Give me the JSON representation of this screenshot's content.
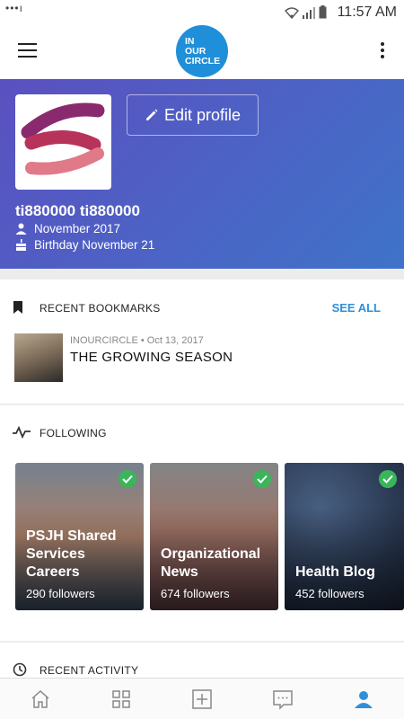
{
  "status_bar": {
    "time": "11:57 AM"
  },
  "app_bar": {
    "logo_text_1": "IN",
    "logo_text_2": "OUR",
    "logo_text_3": "CIRCLE",
    "brand_color": "#1f8fd9"
  },
  "profile": {
    "edit_label": "Edit profile",
    "username": "ti880000 ti880000",
    "joined": "November 2017",
    "birthday": "Birthday November 21",
    "header_colors": [
      "#5b50c0",
      "#3f73c9"
    ]
  },
  "bookmarks": {
    "title": "RECENT BOOKMARKS",
    "see_all": "SEE ALL",
    "item": {
      "source": "INOURCIRCLE",
      "date": "Oct 13, 2017",
      "title": "THE GROWING SEASON"
    }
  },
  "following": {
    "title": "FOLLOWING",
    "cards": [
      {
        "name_1": "PSJH Shared",
        "name_2": "Services Careers",
        "followers": "290 followers"
      },
      {
        "name_1": "Organizational",
        "name_2": "News",
        "followers": "674 followers"
      },
      {
        "name_1": "",
        "name_2": "Health Blog",
        "followers": "452 followers"
      }
    ]
  },
  "activity": {
    "title": "RECENT ACTIVITY"
  },
  "accent_color": "#2f8fd8",
  "check_color": "#3ab55a",
  "bottom_nav": {
    "items": [
      "home-icon",
      "grid-icon",
      "add-icon",
      "chat-icon",
      "profile-icon"
    ],
    "active": "profile-icon"
  }
}
